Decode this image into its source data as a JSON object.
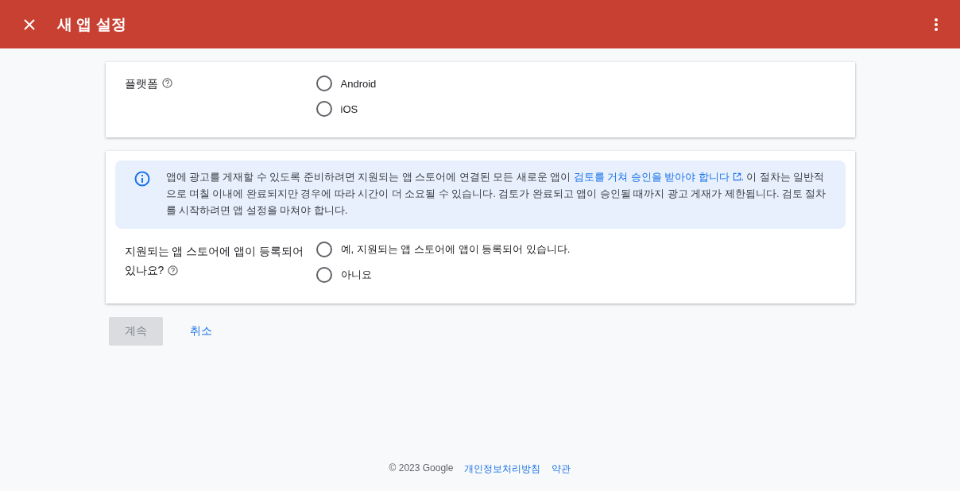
{
  "header": {
    "title": "새 앱 설정"
  },
  "platform": {
    "label": "플랫폼",
    "options": [
      {
        "label": "Android",
        "selected": false
      },
      {
        "label": "iOS",
        "selected": false
      }
    ]
  },
  "info": {
    "text_before": "앱에 광고를 게재할 수 있도록 준비하려면 지원되는 앱 스토어에 연결된 모든 새로운 앱이 ",
    "link": "검토를 거쳐 승인을 받아야 합니다",
    "text_after": ". 이 절차는 일반적으로 며칠 이내에 완료되지만 경우에 따라 시간이 더 소요될 수 있습니다. 검토가 완료되고 앱이 승인될 때까지 광고 게재가 제한됩니다. 검토 절차를 시작하려면 앱 설정을 마쳐야 합니다."
  },
  "store": {
    "label": "지원되는 앱 스토어에 앱이 등록되어 있나요?",
    "options": [
      {
        "label": "예, 지원되는 앱 스토어에 앱이 등록되어 있습니다.",
        "selected": false
      },
      {
        "label": "아니요",
        "selected": false
      }
    ]
  },
  "buttons": [
    {
      "kind": "primary",
      "label": "계속",
      "disabled": true
    },
    {
      "kind": "text",
      "label": "취소",
      "disabled": false
    }
  ],
  "footer": {
    "copyright": "© 2023 Google",
    "links": [
      "개인정보처리방침",
      "약관"
    ]
  }
}
